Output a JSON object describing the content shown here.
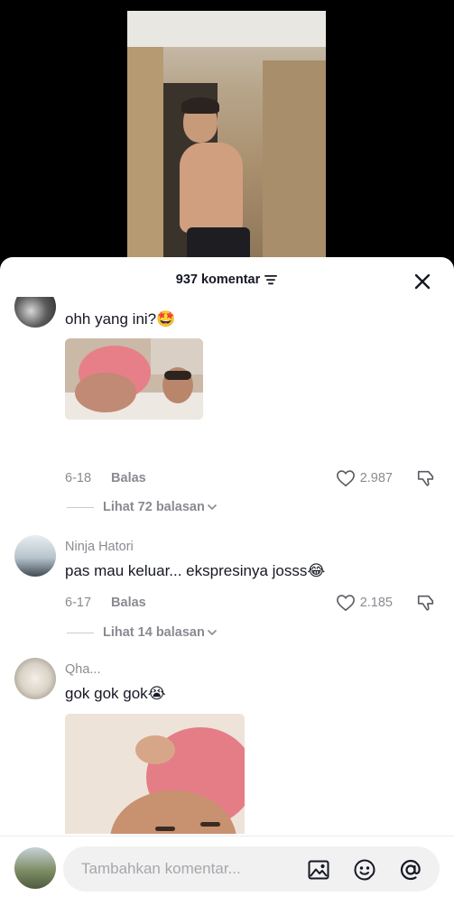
{
  "sheet": {
    "comment_count_label": "937 komentar",
    "sort_icon": "filter-lines-icon",
    "close_icon": "close-icon"
  },
  "comments": [
    {
      "username": "",
      "text": "ohh yang ini?",
      "emoji": "🤩",
      "has_image": true,
      "date": "6-18",
      "reply_label": "Balas",
      "likes": "2.987",
      "view_replies": "Lihat 72 balasan"
    },
    {
      "username": "Ninja Hatori",
      "text": "pas mau keluar... ekspresinya josss",
      "emoji": "😂",
      "has_image": false,
      "date": "6-17",
      "reply_label": "Balas",
      "likes": "2.185",
      "view_replies": "Lihat 14 balasan"
    },
    {
      "username": "Qha...",
      "text": "gok gok gok",
      "emoji": "😭",
      "has_image": true
    }
  ],
  "input": {
    "placeholder": "Tambahkan komentar...",
    "icons": [
      "image-icon",
      "emoji-icon",
      "mention-icon"
    ]
  },
  "colors": {
    "text_primary": "#161823",
    "text_secondary": "#8a8b91",
    "input_bg": "#f1f1f2",
    "accent_hair": "#e87f86"
  }
}
